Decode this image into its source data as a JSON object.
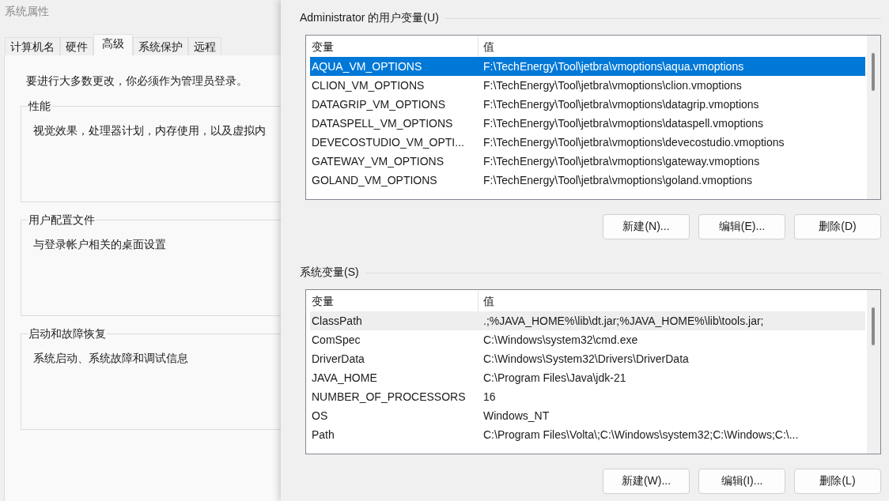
{
  "back_window": {
    "title": "系统属性",
    "tabs": [
      {
        "label": "计算机名",
        "selected": false
      },
      {
        "label": "硬件",
        "selected": false
      },
      {
        "label": "高级",
        "selected": true
      },
      {
        "label": "系统保护",
        "selected": false
      },
      {
        "label": "远程",
        "selected": false
      }
    ],
    "notice": "要进行大多数更改，你必须作为管理员登录。",
    "groups": [
      {
        "title": "性能",
        "text": "视觉效果，处理器计划，内存使用，以及虚拟内"
      },
      {
        "title": "用户配置文件",
        "text": "与登录帐户相关的桌面设置"
      },
      {
        "title": "启动和故障恢复",
        "text": "系统启动、系统故障和调试信息"
      }
    ]
  },
  "sections": [
    {
      "title": "Administrator 的用户变量(U)",
      "columns": [
        "变量",
        "值"
      ],
      "rows": [
        {
          "name": "AQUA_VM_OPTIONS",
          "value": "F:\\TechEnergy\\Tool\\jetbra\\vmoptions\\aqua.vmoptions",
          "selected": true,
          "hovered": false
        },
        {
          "name": "CLION_VM_OPTIONS",
          "value": "F:\\TechEnergy\\Tool\\jetbra\\vmoptions\\clion.vmoptions",
          "selected": false,
          "hovered": false
        },
        {
          "name": "DATAGRIP_VM_OPTIONS",
          "value": "F:\\TechEnergy\\Tool\\jetbra\\vmoptions\\datagrip.vmoptions",
          "selected": false,
          "hovered": false
        },
        {
          "name": "DATASPELL_VM_OPTIONS",
          "value": "F:\\TechEnergy\\Tool\\jetbra\\vmoptions\\dataspell.vmoptions",
          "selected": false,
          "hovered": false
        },
        {
          "name": "DEVECOSTUDIO_VM_OPTI...",
          "value": "F:\\TechEnergy\\Tool\\jetbra\\vmoptions\\devecostudio.vmoptions",
          "selected": false,
          "hovered": false
        },
        {
          "name": "GATEWAY_VM_OPTIONS",
          "value": "F:\\TechEnergy\\Tool\\jetbra\\vmoptions\\gateway.vmoptions",
          "selected": false,
          "hovered": false
        },
        {
          "name": "GOLAND_VM_OPTIONS",
          "value": "F:\\TechEnergy\\Tool\\jetbra\\vmoptions\\goland.vmoptions",
          "selected": false,
          "hovered": false
        }
      ],
      "buttons": [
        "新建(N)...",
        "编辑(E)...",
        "删除(D)"
      ]
    },
    {
      "title": "系统变量(S)",
      "columns": [
        "变量",
        "值"
      ],
      "rows": [
        {
          "name": "ClassPath",
          "value": ".;%JAVA_HOME%\\lib\\dt.jar;%JAVA_HOME%\\lib\\tools.jar;",
          "selected": false,
          "hovered": true
        },
        {
          "name": "ComSpec",
          "value": "C:\\Windows\\system32\\cmd.exe",
          "selected": false,
          "hovered": false
        },
        {
          "name": "DriverData",
          "value": "C:\\Windows\\System32\\Drivers\\DriverData",
          "selected": false,
          "hovered": false
        },
        {
          "name": "JAVA_HOME",
          "value": "C:\\Program Files\\Java\\jdk-21",
          "selected": false,
          "hovered": false
        },
        {
          "name": "NUMBER_OF_PROCESSORS",
          "value": "16",
          "selected": false,
          "hovered": false
        },
        {
          "name": "OS",
          "value": "Windows_NT",
          "selected": false,
          "hovered": false
        },
        {
          "name": "Path",
          "value": "C:\\Program Files\\Volta\\;C:\\Windows\\system32;C:\\Windows;C:\\...",
          "selected": false,
          "hovered": false
        }
      ],
      "buttons": [
        "新建(W)...",
        "编辑(I)...",
        "删除(L)"
      ]
    }
  ]
}
